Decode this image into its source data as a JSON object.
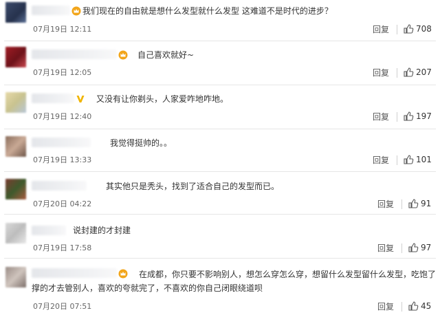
{
  "actions": {
    "reply_label": "回复"
  },
  "colors": {
    "crown_badge": "#f2a51a",
    "verified_badge": "#f0b400",
    "separator": "#e6e6e6"
  },
  "comments": [
    {
      "text": "我们现在的自由就是想什么发型就什么发型 这难道不是时代的进步？",
      "time": "07月19日 12:11",
      "likes": "708",
      "badge": "crown-icon"
    },
    {
      "text": "自己喜欢就好~",
      "time": "07月19日 12:05",
      "likes": "207",
      "badge": "crown-icon"
    },
    {
      "text": "又没有让你剃头，人家爱咋地咋地。",
      "time": "07月19日 12:40",
      "likes": "197",
      "badge": "verified-v-icon"
    },
    {
      "text": "我觉得挺帅的。。",
      "time": "07月19日 13:33",
      "likes": "101",
      "badge": ""
    },
    {
      "text": "其实他只是秃头，找到了适合自己的发型而已。",
      "time": "07月20日 04:22",
      "likes": "91",
      "badge": ""
    },
    {
      "text": "说封建的才封建",
      "time": "07月19日 17:58",
      "likes": "97",
      "badge": ""
    },
    {
      "text": "在成都，你只要不影响别人，想怎么穿怎么穿，想留什么发型留什么发型，吃饱了撑的才去管别人，喜欢的夸就完了，不喜欢的你自己闭眼绕道呗",
      "time": "07月20日 07:51",
      "likes": "45",
      "badge": "crown-icon"
    }
  ]
}
